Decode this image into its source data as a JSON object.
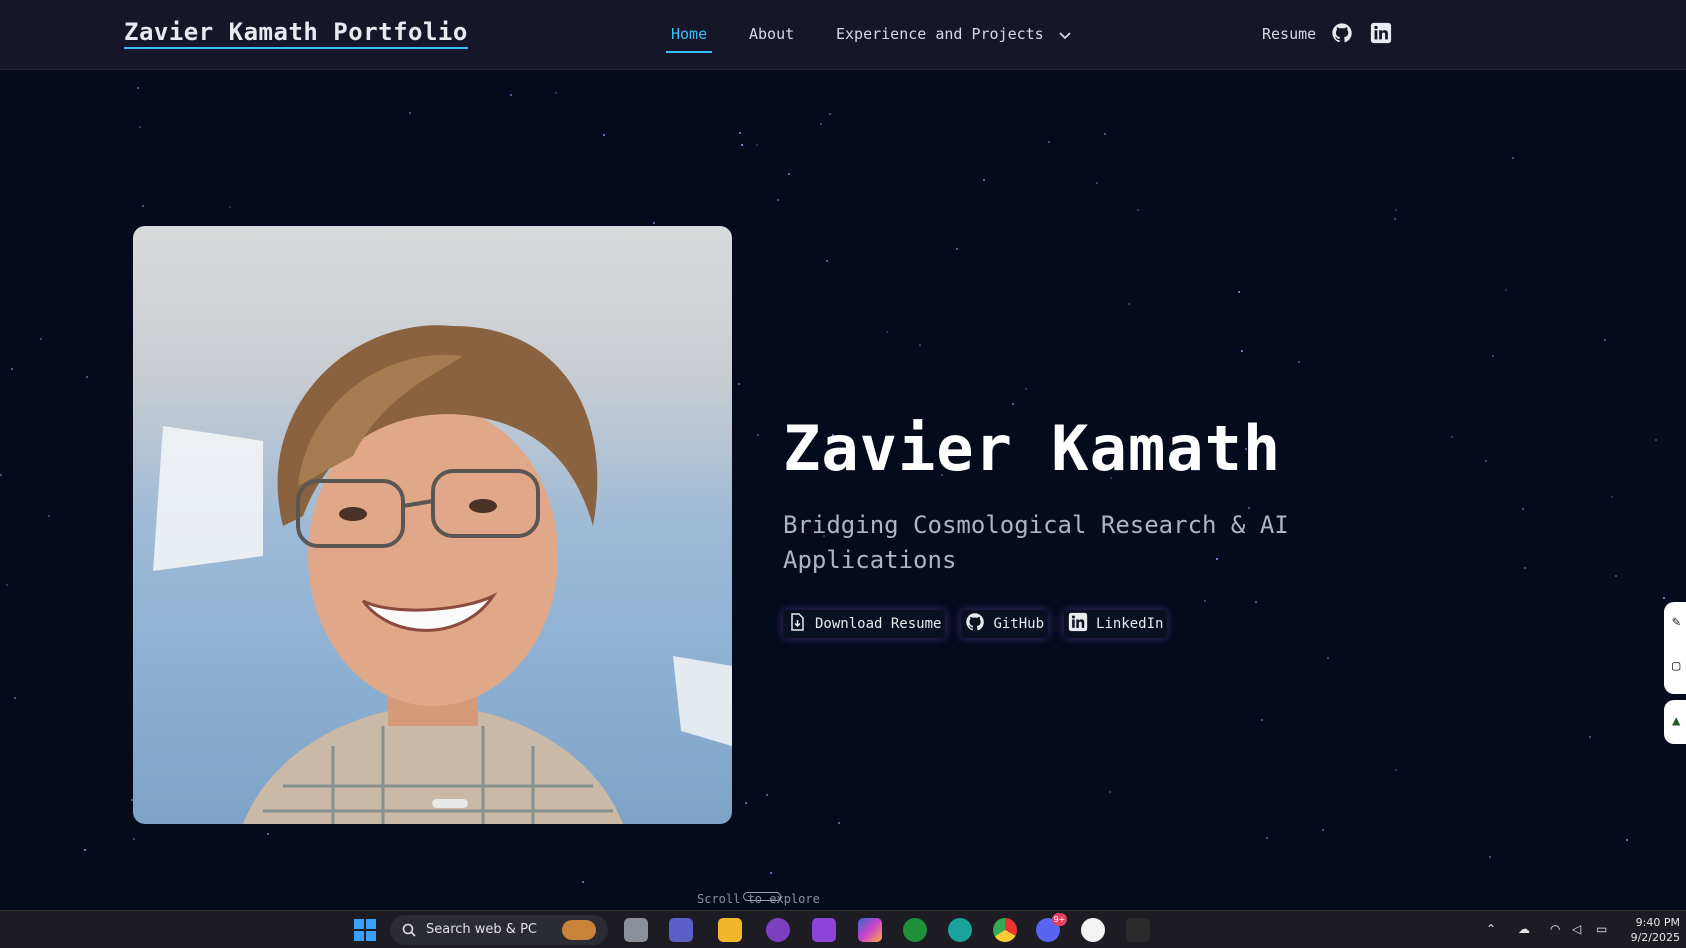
{
  "nav": {
    "brand": "Zavier Kamath Portfolio",
    "links": [
      {
        "label": "Home",
        "active": true
      },
      {
        "label": "About",
        "active": false
      },
      {
        "label": "Experience and Projects",
        "active": false,
        "has_dropdown": true
      }
    ],
    "resume_label": "Resume",
    "icons": [
      "github-icon",
      "linkedin-icon"
    ],
    "accent_color": "#38bdf8"
  },
  "hero": {
    "photo_alt": "Portrait photo",
    "name": "Zavier Kamath",
    "subtitle": "Bridging Cosmological Research & AI Applications",
    "buttons": [
      {
        "label": "Download Resume",
        "icon": "download-file-icon"
      },
      {
        "label": "GitHub",
        "icon": "github-icon"
      },
      {
        "label": "LinkedIn",
        "icon": "linkedin-icon"
      }
    ],
    "scroll_hint": "Scroll to explore"
  },
  "taskbar": {
    "search_text": "Search web & PC",
    "apps": [
      "windows-start-icon",
      "search-icon",
      "task-view-icon",
      "teams-icon",
      "file-explorer-icon",
      "tor-icon",
      "proton-icon",
      "copilot-icon",
      "xbox-icon",
      "edge-icon",
      "chrome-icon",
      "discord-icon",
      "slack-icon",
      "unknown-app-icon"
    ],
    "discord_badge": "9+",
    "time": "9:40 PM",
    "date": "9/2/2025"
  },
  "colors": {
    "background": "#050a1c",
    "nav_bg": "#161629",
    "accent": "#38bdf8"
  }
}
